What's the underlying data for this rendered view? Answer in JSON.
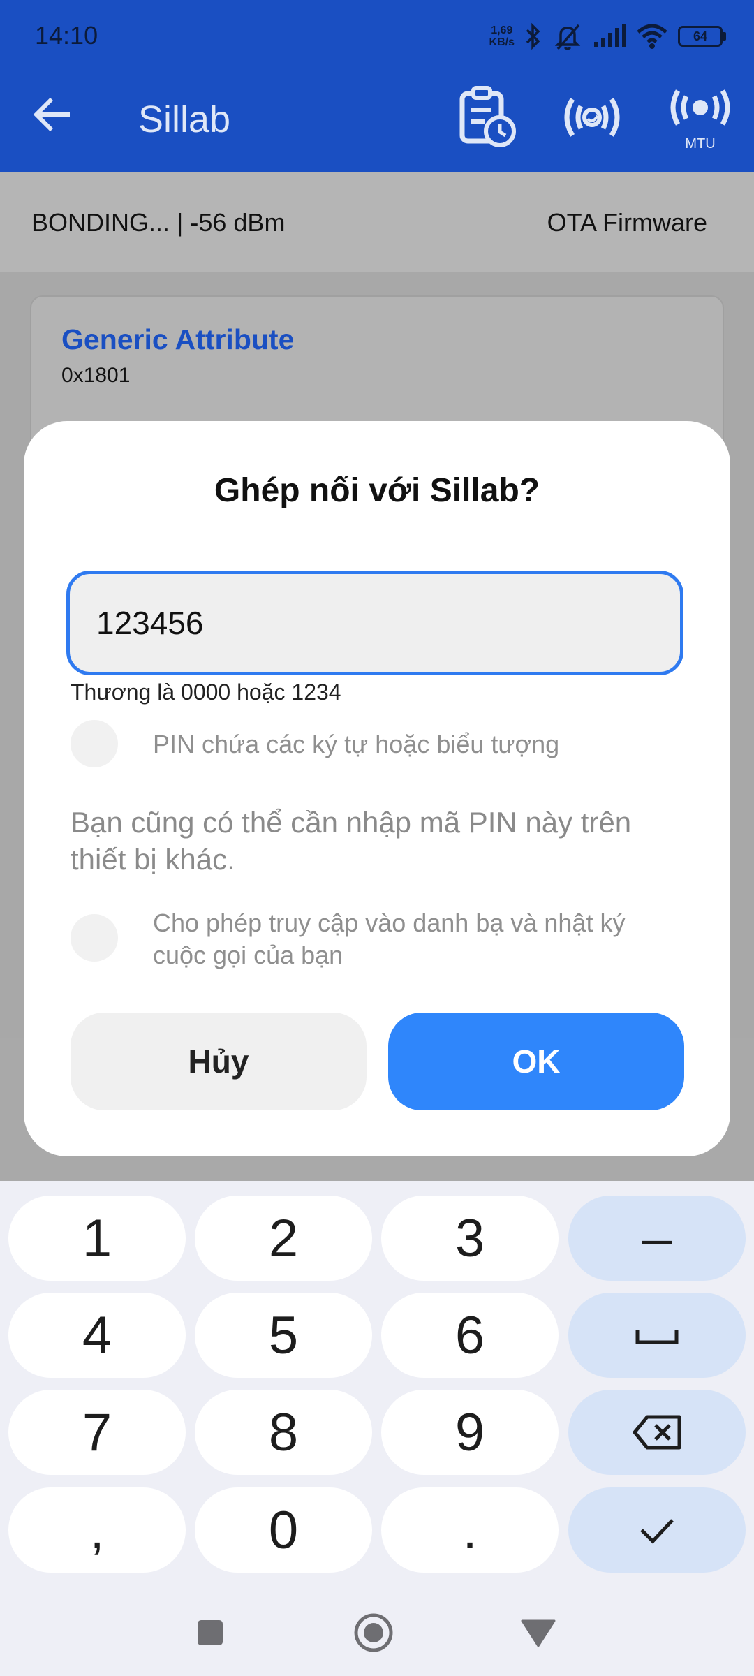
{
  "status": {
    "time": "14:10",
    "net_speed_value": "1,69",
    "net_speed_unit": "KB/s",
    "battery": "64"
  },
  "appbar": {
    "title": "Sillab",
    "mtu_label": "MTU"
  },
  "info": {
    "connection": "BONDING... | -56 dBm",
    "ota": "OTA Firmware"
  },
  "service": {
    "name": "Generic Attribute",
    "uuid": "0x1801"
  },
  "dialog": {
    "title": "Ghép nối với Sillab?",
    "pin_value": "123456",
    "hint": "Thương là 0000 hoặc 1234",
    "option_pin_symbols": "PIN chứa các ký tự hoặc biểu tượng",
    "note": "Bạn cũng có thể cần nhập mã PIN này trên thiết bị khác.",
    "option_contacts": "Cho phép truy cập vào danh bạ và nhật ký cuộc gọi của bạn",
    "cancel": "Hủy",
    "ok": "OK"
  },
  "keyboard": {
    "k1": "1",
    "k2": "2",
    "k3": "3",
    "minus": "–",
    "k4": "4",
    "k5": "5",
    "k6": "6",
    "k7": "7",
    "k8": "8",
    "k9": "9",
    "comma": ",",
    "k0": "0",
    "dot": "."
  },
  "colors": {
    "appbar": "#1a4fc2",
    "accent": "#2f86fb",
    "keyboard_bg": "#eeeff6",
    "fn_key": "#d6e3f7"
  }
}
